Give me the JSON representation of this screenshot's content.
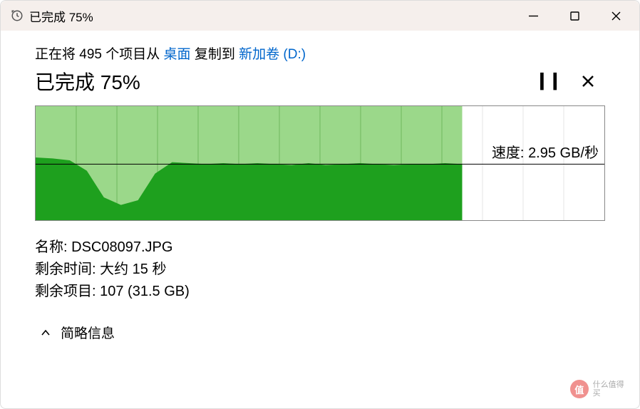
{
  "titlebar": {
    "title": "已完成 75%"
  },
  "operation": {
    "prefix": "正在将 ",
    "count": "495",
    "mid1": " 个项目从 ",
    "source": "桌面",
    "mid2": " 复制到 ",
    "dest": "新加卷 (D:)"
  },
  "progress": {
    "text": "已完成 75%"
  },
  "speed": {
    "label": "速度: ",
    "value": "2.95 GB/秒"
  },
  "details": {
    "name_label": "名称: ",
    "name_value": "DSC08097.JPG",
    "time_label": "剩余时间: ",
    "time_value": "大约 15 秒",
    "items_label": "剩余项目: ",
    "items_value": "107 (31.5 GB)"
  },
  "toggle": {
    "label": "简略信息"
  },
  "watermark": {
    "text": "什么值得买"
  },
  "chart_data": {
    "type": "area",
    "progress_fraction": 0.75,
    "ylabel": "Transfer speed",
    "ylim": [
      0,
      6
    ],
    "unit": "GB/秒",
    "current_speed": 2.95,
    "x_normalized": [
      0.0,
      0.03,
      0.06,
      0.09,
      0.12,
      0.15,
      0.18,
      0.21,
      0.24,
      0.27,
      0.3,
      0.33,
      0.36,
      0.39,
      0.42,
      0.45,
      0.48,
      0.51,
      0.54,
      0.57,
      0.6,
      0.63,
      0.66,
      0.69,
      0.72,
      0.75
    ],
    "values": [
      3.3,
      3.25,
      3.15,
      2.6,
      1.2,
      0.8,
      1.05,
      2.45,
      3.05,
      3.0,
      2.95,
      3.0,
      2.95,
      3.0,
      2.95,
      2.9,
      3.0,
      2.9,
      2.95,
      3.0,
      2.95,
      2.9,
      2.95,
      2.95,
      3.0,
      2.95
    ],
    "grid_verticals_normalized": [
      0.0714,
      0.1429,
      0.2143,
      0.2857,
      0.3571,
      0.4286,
      0.5,
      0.5714,
      0.6429,
      0.7143,
      0.7857,
      0.8571,
      0.9286
    ]
  }
}
